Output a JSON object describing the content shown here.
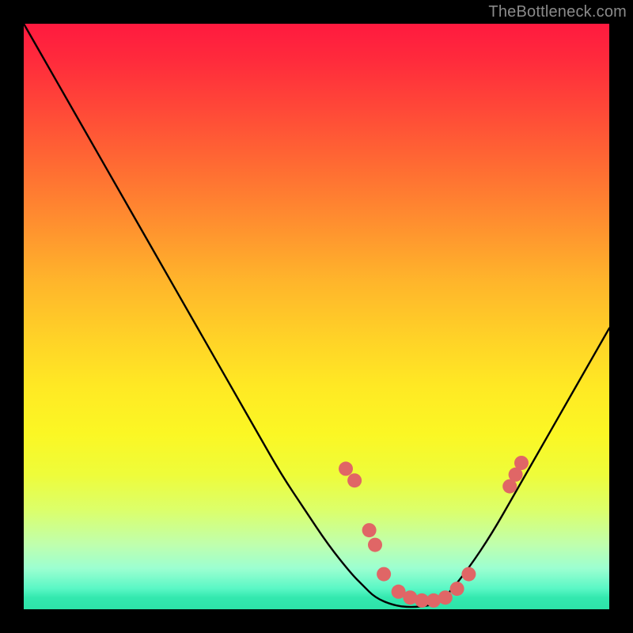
{
  "watermark": "TheBottleneck.com",
  "chart_data": {
    "type": "line",
    "title": "",
    "xlabel": "",
    "ylabel": "",
    "xlim": [
      0,
      100
    ],
    "ylim": [
      0,
      100
    ],
    "grid": false,
    "legend": false,
    "background_gradient": {
      "stops": [
        {
          "pos": 0.0,
          "color": "#ff1a3f"
        },
        {
          "pos": 0.3,
          "color": "#ff7a32"
        },
        {
          "pos": 0.55,
          "color": "#ffd327"
        },
        {
          "pos": 0.78,
          "color": "#e8fc45"
        },
        {
          "pos": 0.92,
          "color": "#b4ffb1"
        },
        {
          "pos": 1.0,
          "color": "#2de3a8"
        }
      ]
    },
    "series": [
      {
        "name": "bottleneck-curve",
        "color": "#000000",
        "x": [
          0,
          4,
          8,
          12,
          16,
          20,
          24,
          28,
          32,
          36,
          40,
          44,
          48,
          52,
          56,
          58,
          60,
          63,
          66,
          70,
          72,
          76,
          80,
          84,
          88,
          92,
          96,
          100
        ],
        "y": [
          100,
          93,
          86,
          79,
          72,
          65,
          58,
          51,
          44,
          37,
          30,
          23,
          17,
          11,
          6,
          4,
          2,
          0.7,
          0.3,
          0.7,
          2,
          7,
          13,
          20,
          27,
          34,
          41,
          48
        ]
      }
    ],
    "markers": {
      "name": "highlight-dots",
      "color": "#e06666",
      "radius": 9,
      "points": [
        {
          "x": 55,
          "y": 24
        },
        {
          "x": 56.5,
          "y": 22
        },
        {
          "x": 59,
          "y": 13.5
        },
        {
          "x": 60,
          "y": 11
        },
        {
          "x": 61.5,
          "y": 6
        },
        {
          "x": 64,
          "y": 3
        },
        {
          "x": 66,
          "y": 2
        },
        {
          "x": 68,
          "y": 1.5
        },
        {
          "x": 70,
          "y": 1.5
        },
        {
          "x": 72,
          "y": 2
        },
        {
          "x": 74,
          "y": 3.5
        },
        {
          "x": 76,
          "y": 6
        },
        {
          "x": 83,
          "y": 21
        },
        {
          "x": 84,
          "y": 23
        },
        {
          "x": 85,
          "y": 25
        }
      ]
    }
  }
}
